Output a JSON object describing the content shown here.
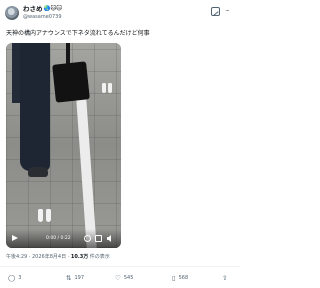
{
  "author": {
    "display_name": "わさめ",
    "badges": "🌏🐱🐱",
    "handle": "@wasame0739"
  },
  "tweet": {
    "text": "天神の構内アナウンスで下ネタ流れてるんだけど何事"
  },
  "video": {
    "time": "0:00 / 0:22"
  },
  "meta": {
    "timestamp": "午後4:29 · 2026年8月4日 · ",
    "views_count": "10.3万",
    "views_label": " 件の表示"
  },
  "actions": {
    "replies": "3",
    "reposts": "197",
    "likes": "545",
    "bookmarks": "568"
  },
  "icons": {
    "reply": "speech-bubble",
    "repost": "arrows-loop",
    "like": "heart",
    "bookmark": "bookmark",
    "share": "share-arrow"
  },
  "colors": {
    "text": "#0f1419",
    "secondary": "#536471",
    "divider": "#eff3f4"
  }
}
